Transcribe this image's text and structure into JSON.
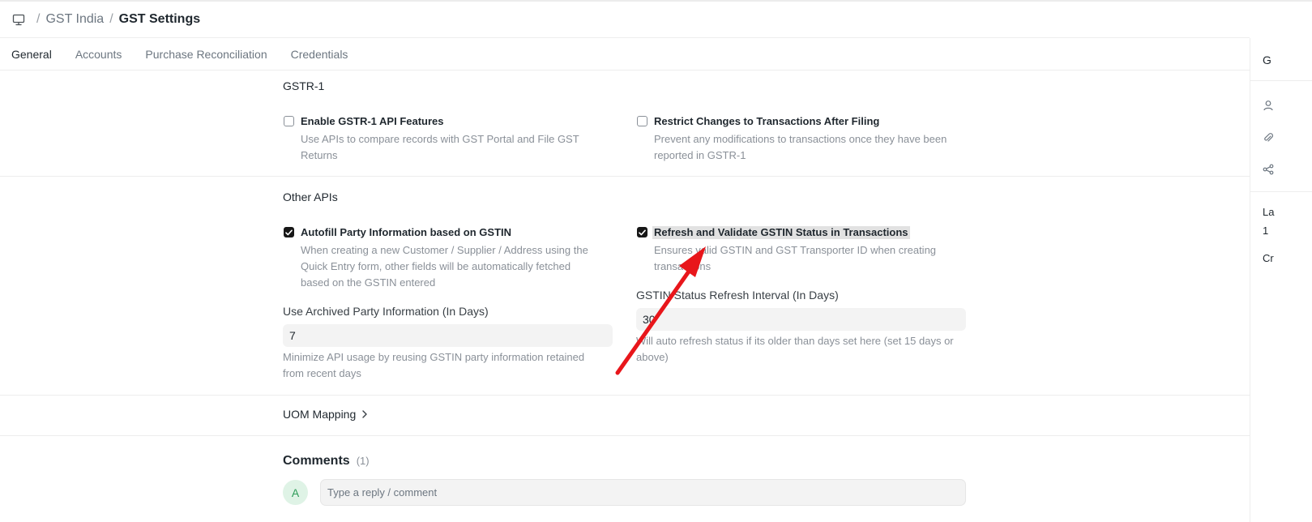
{
  "breadcrumb": {
    "items": [
      "GST India",
      "GST Settings"
    ],
    "separator": "/"
  },
  "tabs": [
    {
      "label": "General",
      "active": true
    },
    {
      "label": "Accounts",
      "active": false
    },
    {
      "label": "Purchase Reconciliation",
      "active": false
    },
    {
      "label": "Credentials",
      "active": false
    }
  ],
  "gstr1": {
    "title": "GSTR-1",
    "enable_api": {
      "label": "Enable GSTR-1 API Features",
      "checked": false,
      "desc_line1": "Use APIs to compare records with GST Portal and File GST",
      "desc_line2": "Returns"
    },
    "restrict_changes": {
      "label": "Restrict Changes to Transactions After Filing",
      "checked": false,
      "desc_line1": "Prevent any modifications to transactions once they have been",
      "desc_line2": "reported in GSTR-1"
    }
  },
  "other_apis": {
    "title": "Other APIs",
    "autofill": {
      "label": "Autofill Party Information based on GSTIN",
      "checked": true,
      "desc_line1": "When creating a new Customer / Supplier / Address using the",
      "desc_line2": "Quick Entry form, other fields will be automatically fetched",
      "desc_line3": "based on the GSTIN entered"
    },
    "refresh_validate": {
      "label": "Refresh and Validate GSTIN Status in Transactions",
      "checked": true,
      "desc_line1": "Ensures valid GSTIN and GST Transporter ID when creating",
      "desc_line2": "transactions"
    },
    "archived_days": {
      "label": "Use Archived Party Information (In Days)",
      "value": "7",
      "desc_line1": "Minimize API usage by reusing GSTIN party information retained",
      "desc_line2": "from recent days"
    },
    "refresh_interval": {
      "label": "GSTIN Status Refresh Interval (In Days)",
      "value": "30",
      "desc_line1": "Will auto refresh status if its older than days set here (set 15 days or",
      "desc_line2": "above)"
    }
  },
  "uom": {
    "label": "UOM Mapping"
  },
  "comments": {
    "title": "Comments",
    "count": "(1)",
    "avatar_initial": "A",
    "placeholder": "Type a reply / comment"
  },
  "sidebar": {
    "top_char": "G",
    "label1": "La",
    "label2": "1",
    "label3": "Cr"
  },
  "colors": {
    "annotation_arrow": "#e8161b",
    "checkbox_checked": "#171717"
  },
  "icons": {
    "desk": "desktop-icon",
    "chevron": "chevron-right-icon"
  }
}
